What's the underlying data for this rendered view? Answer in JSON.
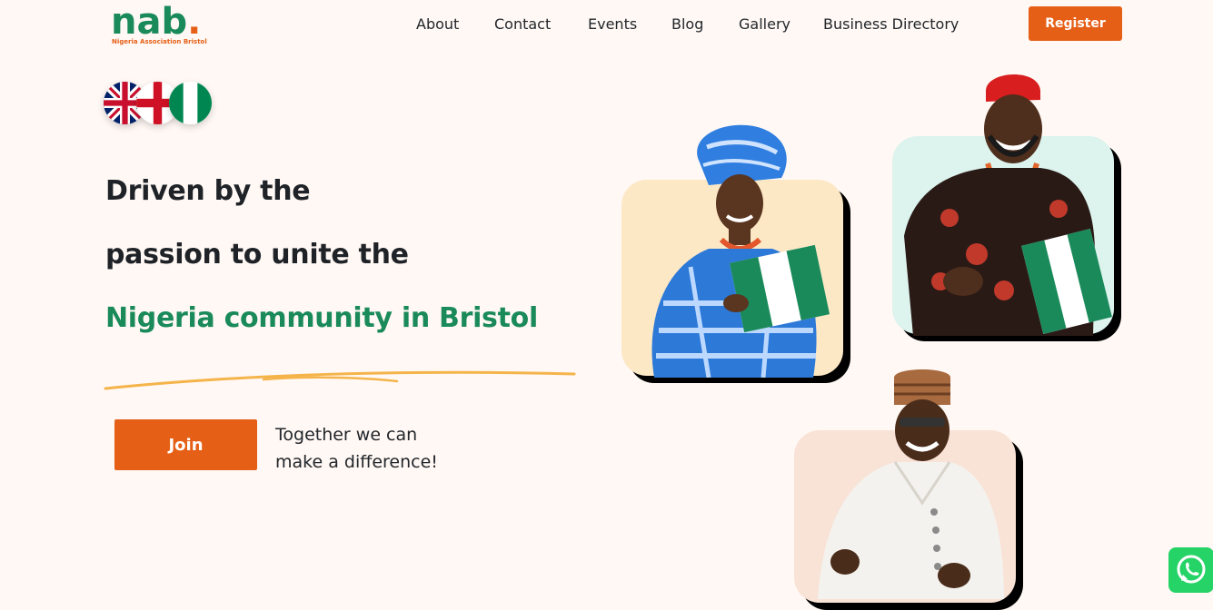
{
  "brand": {
    "logo_text": "nab",
    "logo_dot": ".",
    "logo_subtitle": "Nigeria Association Bristol",
    "primary_green": "#1a8a5a",
    "accent_orange": "#e65f16",
    "background": "#fff8f4"
  },
  "nav": {
    "items": [
      {
        "label": "About"
      },
      {
        "label": "Contact"
      },
      {
        "label": "Events"
      },
      {
        "label": "Blog"
      },
      {
        "label": "Gallery"
      },
      {
        "label": "Business Directory"
      }
    ],
    "register_label": "Register"
  },
  "flags": [
    "uk-flag-icon",
    "england-flag-icon",
    "nigeria-flag-icon"
  ],
  "hero": {
    "line1": "Driven by the",
    "line2": "passion to unite the",
    "line3": "Nigeria community in Bristol",
    "join_label": "Join",
    "tagline_line1": "Together we can",
    "tagline_line2": "make a difference!"
  },
  "floating": {
    "whatsapp_icon": "whatsapp-icon"
  }
}
